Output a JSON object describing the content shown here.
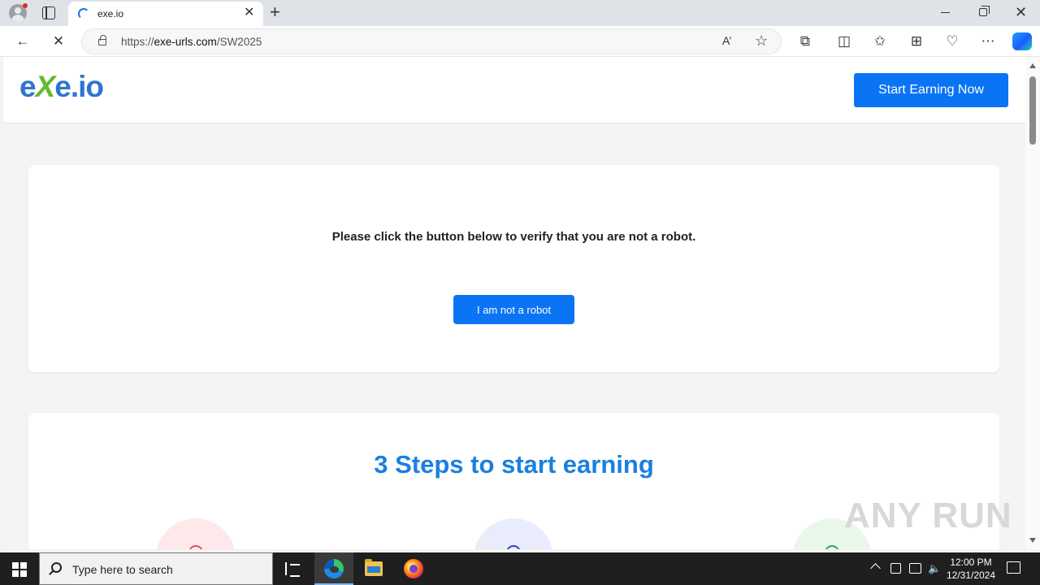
{
  "browser": {
    "tab_title": "exe.io",
    "url_domain": "exe-urls.com",
    "url_path": "/SW2025",
    "url_scheme": "https://",
    "read_aloud_glyph": "A’",
    "icons": [
      "profile-icon",
      "tab-actions-icon",
      "loading-spinner-icon",
      "close-tab-icon",
      "new-tab-icon",
      "back-icon",
      "stop-loading-icon",
      "lock-icon",
      "read-aloud-icon",
      "favorite-star-icon",
      "extensions-icon",
      "split-screen-icon",
      "favorites-icon",
      "collections-icon",
      "browser-essentials-icon",
      "more-icon",
      "copilot-icon"
    ]
  },
  "site": {
    "logo_prefix": "e",
    "logo_x": "X",
    "logo_suffix": "e.io",
    "cta_label": "Start Earning Now",
    "verify_prompt": "Please click the button below to verify that you are not a robot.",
    "robot_button": "I am not a robot",
    "steps_title": "3 Steps to start earning",
    "watermark": "ANY RUN"
  },
  "taskbar": {
    "search_placeholder": "Type here to search",
    "time": "12:00 PM",
    "date": "12/31/2024"
  },
  "colors": {
    "accent_blue": "#0a74f5",
    "title_blue": "#1a7fe0",
    "logo_blue": "#2f74d0",
    "logo_green": "#67b830"
  }
}
